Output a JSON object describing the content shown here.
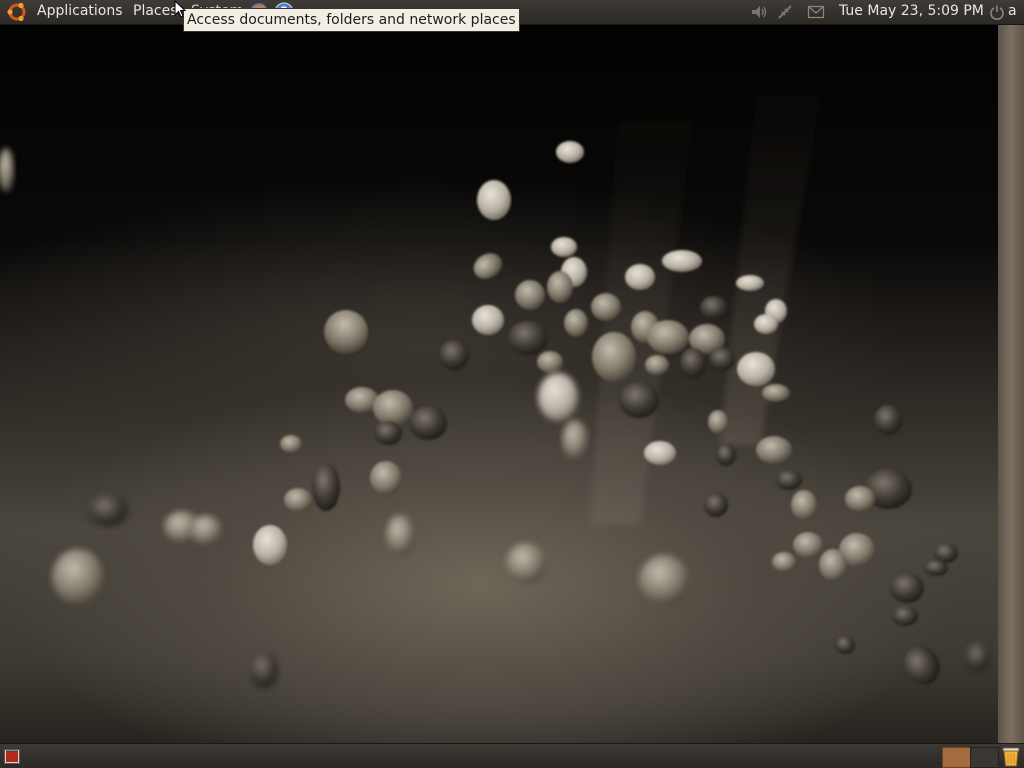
{
  "top_panel": {
    "menus": {
      "applications": "Applications",
      "places": "Places",
      "system": "System"
    },
    "launchers": [
      "firefox-icon",
      "help-icon"
    ],
    "tray_icons": [
      "sound-icon",
      "network-icon",
      "mail-icon"
    ],
    "clock": "Tue May 23,  5:09 PM",
    "user": "a"
  },
  "tooltip": {
    "text": "Access documents, folders and network places"
  },
  "bottom_panel": {
    "icons": [
      "show-desktop-icon",
      "workspace-switcher",
      "trash-icon"
    ]
  },
  "colors": {
    "panel": "#3a3632",
    "accent": "#a46c3e",
    "ubuntu_orange": "#dd4814"
  }
}
